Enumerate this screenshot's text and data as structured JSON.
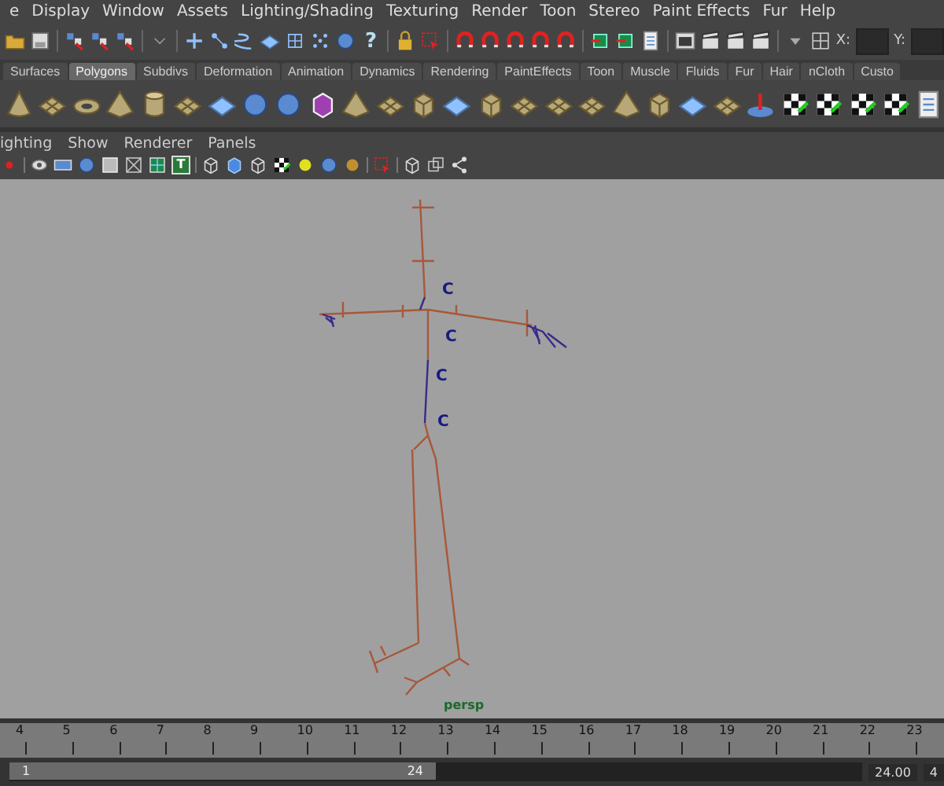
{
  "menu_bar": {
    "items": [
      "e",
      "Display",
      "Window",
      "Assets",
      "Lighting/Shading",
      "Texturing",
      "Render",
      "Toon",
      "Stereo",
      "Paint Effects",
      "Fur",
      "Help"
    ]
  },
  "status_line": {
    "help_symbol": "?",
    "x_label": "X:",
    "y_label": "Y:"
  },
  "shelf": {
    "tabs": [
      {
        "label": "Surfaces",
        "selected": false
      },
      {
        "label": "Polygons",
        "selected": true
      },
      {
        "label": "Subdivs",
        "selected": false
      },
      {
        "label": "Deformation",
        "selected": false
      },
      {
        "label": "Animation",
        "selected": false
      },
      {
        "label": "Dynamics",
        "selected": false
      },
      {
        "label": "Rendering",
        "selected": false
      },
      {
        "label": "PaintEffects",
        "selected": false
      },
      {
        "label": "Toon",
        "selected": false
      },
      {
        "label": "Muscle",
        "selected": false
      },
      {
        "label": "Fluids",
        "selected": false
      },
      {
        "label": "Fur",
        "selected": false
      },
      {
        "label": "Hair",
        "selected": false
      },
      {
        "label": "nCloth",
        "selected": false
      },
      {
        "label": "Custo",
        "selected": false
      }
    ]
  },
  "panel": {
    "menu": [
      "ighting",
      "Show",
      "Renderer",
      "Panels"
    ],
    "text_symbol": "T"
  },
  "viewport": {
    "joint_labels": [
      "C",
      "C",
      "C",
      "C"
    ],
    "camera_label": "persp"
  },
  "time_slider": {
    "ticks": [
      "4",
      "5",
      "6",
      "7",
      "8",
      "9",
      "10",
      "11",
      "12",
      "13",
      "14",
      "15",
      "16",
      "17",
      "18",
      "19",
      "20",
      "21",
      "22",
      "23"
    ]
  },
  "range_slider": {
    "level": 0.5,
    "start": "1",
    "end": "24",
    "current_time": "24.00",
    "end_field": "4"
  }
}
